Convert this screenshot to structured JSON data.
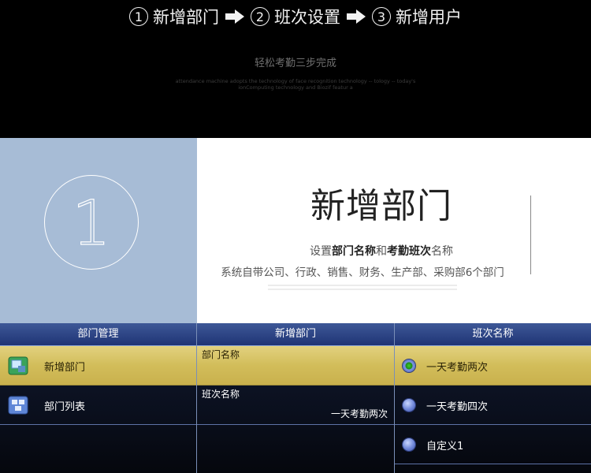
{
  "banner": {
    "steps": [
      {
        "num": "1",
        "label": "新增部门"
      },
      {
        "num": "2",
        "label": "班次设置"
      },
      {
        "num": "3",
        "label": "新增用户"
      }
    ],
    "subtitle": "轻松考勤三步完成",
    "en_line1": "attendance machine adopts the technology of face recognition technology -- tology -- today's",
    "en_line2": "ionComputing technology and Biozif featur a"
  },
  "hero": {
    "number": "1",
    "title": "新增部门",
    "line1_pre": "设置",
    "line1_b1": "部门名称",
    "line1_mid": "和",
    "line1_b2": "考勤班次",
    "line1_post": "名称",
    "line2": "系统自带公司、行政、销售、财务、生产部、采购部6个部门"
  },
  "panels": {
    "dept_mgmt": {
      "title": "部门管理",
      "items": [
        {
          "label": "新增部门",
          "icon": "add-department-icon"
        },
        {
          "label": "部门列表",
          "icon": "department-list-icon"
        }
      ]
    },
    "add_dept": {
      "title": "新增部门",
      "fields": [
        {
          "label": "部门名称",
          "value": ""
        },
        {
          "label": "班次名称",
          "value": "一天考勤两次"
        }
      ]
    },
    "shift_name": {
      "title": "班次名称",
      "options": [
        "一天考勤两次",
        "一天考勤四次",
        "自定义1"
      ],
      "selected": 0
    }
  },
  "colors": {
    "hero_left_bg": "#a7bcd6",
    "selected_row": "#d2bd5a",
    "panel_header": "#2c4385"
  }
}
